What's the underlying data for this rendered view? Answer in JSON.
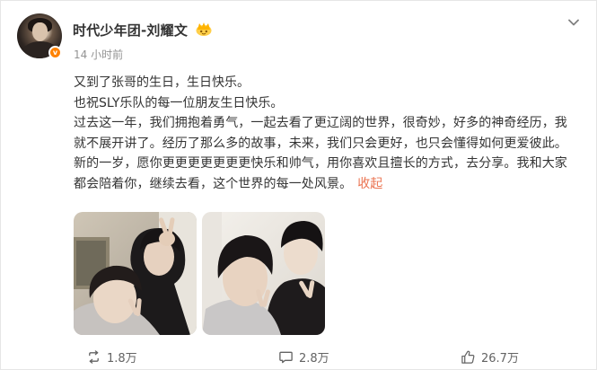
{
  "author": {
    "name": "时代少年团-刘耀文",
    "badge_icon": "crown-badge-icon",
    "verified_icon": "verified-v-icon",
    "verified_color": "#ff8200"
  },
  "post": {
    "timestamp": "14 小时前",
    "lines": [
      "又到了张哥的生日，生日快乐。",
      "也祝SLY乐队的每一位朋友生日快乐。",
      "过去这一年，我们拥抱着勇气，一起去看了更辽阔的世界，很奇妙，好多的神奇经历，我就不展开讲了。经历了那么多的故事，未来，我们只会更好，也只会懂得如何更爱彼此。新的一岁，愿你更更更更更更更快乐和帅气，用你喜欢且擅长的方式，去分享。我和大家都会陪着你，继续去看，这个世界的每一处风景。"
    ],
    "collapse_label": "收起",
    "link_color": "#eb7350",
    "images": [
      {
        "name": "photo-selfie-1"
      },
      {
        "name": "photo-selfie-2"
      }
    ]
  },
  "actions": {
    "repost": {
      "icon": "repost-icon",
      "count": "1.8万"
    },
    "comment": {
      "icon": "comment-icon",
      "count": "2.8万"
    },
    "like": {
      "icon": "thumbs-up-icon",
      "count": "26.7万"
    }
  },
  "menu": {
    "icon": "more-chevron-icon"
  }
}
